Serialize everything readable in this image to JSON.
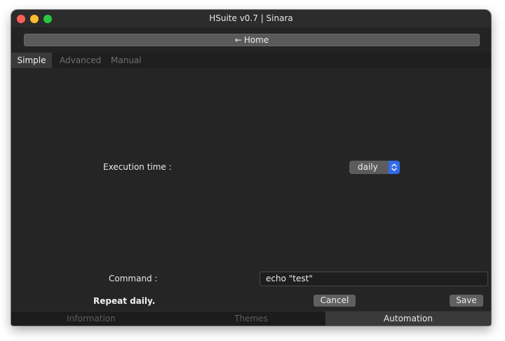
{
  "window": {
    "title": "HSuite v0.7 | Sinara"
  },
  "home_button": {
    "label": "Home",
    "icon": "arrow-left-icon"
  },
  "tabs": [
    {
      "label": "Simple",
      "active": true
    },
    {
      "label": "Advanced",
      "active": false
    },
    {
      "label": "Manual",
      "active": false
    }
  ],
  "form": {
    "execution_time_label": "Execution time :",
    "execution_time_value": "daily",
    "command_label": "Command :",
    "command_value": "echo \"test\"",
    "summary": "Repeat daily."
  },
  "buttons": {
    "cancel": "Cancel",
    "save": "Save"
  },
  "bottom_tabs": [
    {
      "label": "Information",
      "active": false
    },
    {
      "label": "Themes",
      "active": false
    },
    {
      "label": "Automation",
      "active": true
    }
  ],
  "colors": {
    "close": "#fe5f57",
    "minimize": "#febc2e",
    "zoom": "#28c840",
    "accent": "#2f6be6",
    "background": "#252525"
  }
}
